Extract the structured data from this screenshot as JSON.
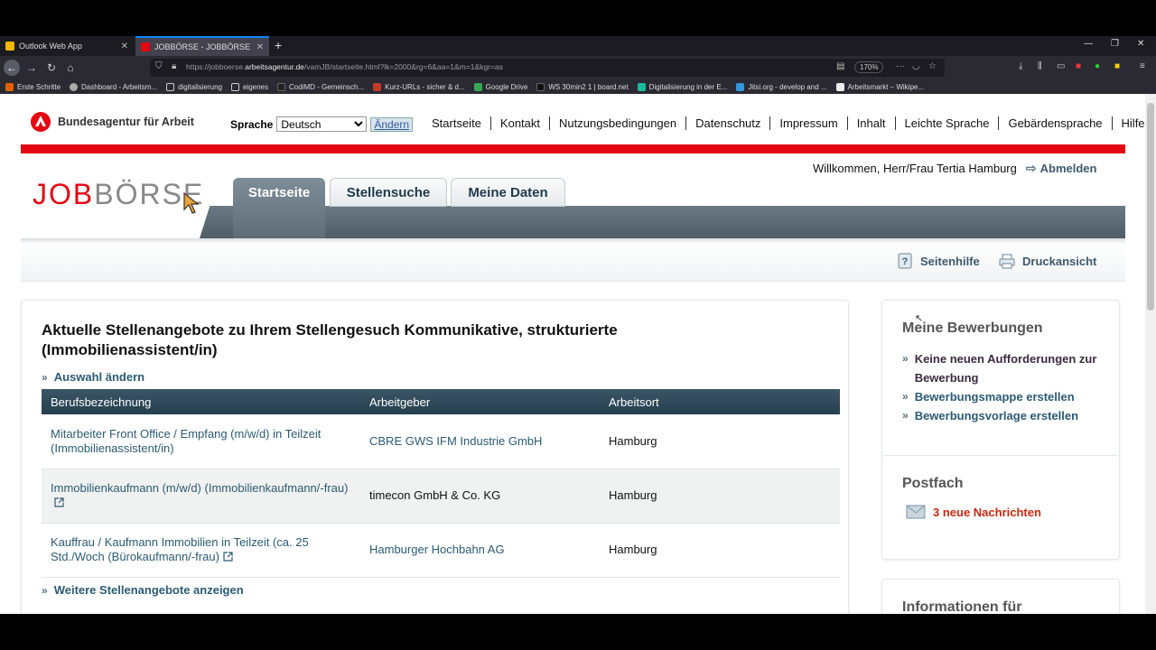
{
  "browser": {
    "tabs": [
      {
        "title": "Outlook Web App",
        "favicon_color": "#f5b800"
      },
      {
        "title": "JOBBÖRSE - JOBBÖRSE der Bu",
        "favicon_color": "#e30613"
      }
    ],
    "url_prefix": "https://jobboerse.",
    "url_host": "arbeitsagentur.de",
    "url_path": "/vamJB/startseite.html?lk=2000&rg=6&aa=1&m=1&kgr=as",
    "zoom": "170%",
    "bookmarks": [
      {
        "label": "Erste Schritte",
        "color": "#e66000"
      },
      {
        "label": "Dashboard - Arbeitsm...",
        "color": "#aaaaaa"
      },
      {
        "label": "digitalisierung",
        "color": "#cccccc"
      },
      {
        "label": "eigenes",
        "color": "#cccccc"
      },
      {
        "label": "CodiMD - Gemeinsch...",
        "color": "#222222"
      },
      {
        "label": "Kurz-URLs - sicher & d...",
        "color": "#c0392b"
      },
      {
        "label": "Google Drive",
        "color": "#34a853"
      },
      {
        "label": "WS 30min2 1 | board.net",
        "color": "#111111"
      },
      {
        "label": "Digitalisierung in der E...",
        "color": "#1abc9c"
      },
      {
        "label": "Jitsi.org - develop and ...",
        "color": "#3498db"
      },
      {
        "label": "Arbeitsmarkt – Wikipe...",
        "color": "#eeeeee"
      }
    ]
  },
  "header": {
    "org_name": "Bundesagentur für Arbeit",
    "language_label": "Sprache",
    "language_value": "Deutsch",
    "language_button": "Ändern",
    "topnav": [
      "Startseite",
      "Kontakt",
      "Nutzungsbedingungen",
      "Datenschutz",
      "Impressum",
      "Inhalt",
      "Leichte Sprache",
      "Gebärdensprache",
      "Hilfe"
    ],
    "welcome": "Willkommen, Herr/Frau Tertia Hamburg",
    "logout": "Abmelden",
    "logo_part1": "JOB",
    "logo_part2": "BÖRSE"
  },
  "tabs": [
    "Startseite",
    "Stellensuche",
    "Meine Daten"
  ],
  "tools": {
    "help": "Seitenhilfe",
    "print": "Druckansicht"
  },
  "main": {
    "heading": "Aktuelle Stellenangebote zu Ihrem Stellengesuch Kommunikative, strukturierte (Immobilienassistent/in)",
    "change_selection": "Auswahl ändern",
    "columns": [
      "Berufsbezeichnung",
      "Arbeitgeber",
      "Arbeitsort"
    ],
    "rows": [
      {
        "title": "Mitarbeiter Front Office / Empfang (m/w/d) in Teilzeit (Immobilienassistent/in)",
        "employer": "CBRE GWS IFM Industrie GmbH",
        "location": "Hamburg"
      },
      {
        "title": "Immobilienkaufmann (m/w/d) (Immobilienkaufmann/-frau)",
        "employer": "timecon GmbH & Co. KG",
        "location": "Hamburg"
      },
      {
        "title": "Kauffrau / Kaufmann Immobilien in Teilzeit (ca. 25 Std./Woch (Bürokaufmann/-frau)",
        "employer": "Hamburger Hochbahn AG",
        "location": "Hamburg"
      }
    ],
    "more_offers": "Weitere Stellenangebote anzeigen"
  },
  "sidebar": {
    "applications_title": "Meine Bewerbungen",
    "applications_links": [
      "Keine neuen Aufforderungen zur Bewerbung",
      "Bewerbungsmappe erstellen",
      "Bewerbungsvorlage erstellen"
    ],
    "mailbox_title": "Postfach",
    "mailbox_message": "3 neue Nachrichten",
    "info_title": "Informationen für"
  }
}
